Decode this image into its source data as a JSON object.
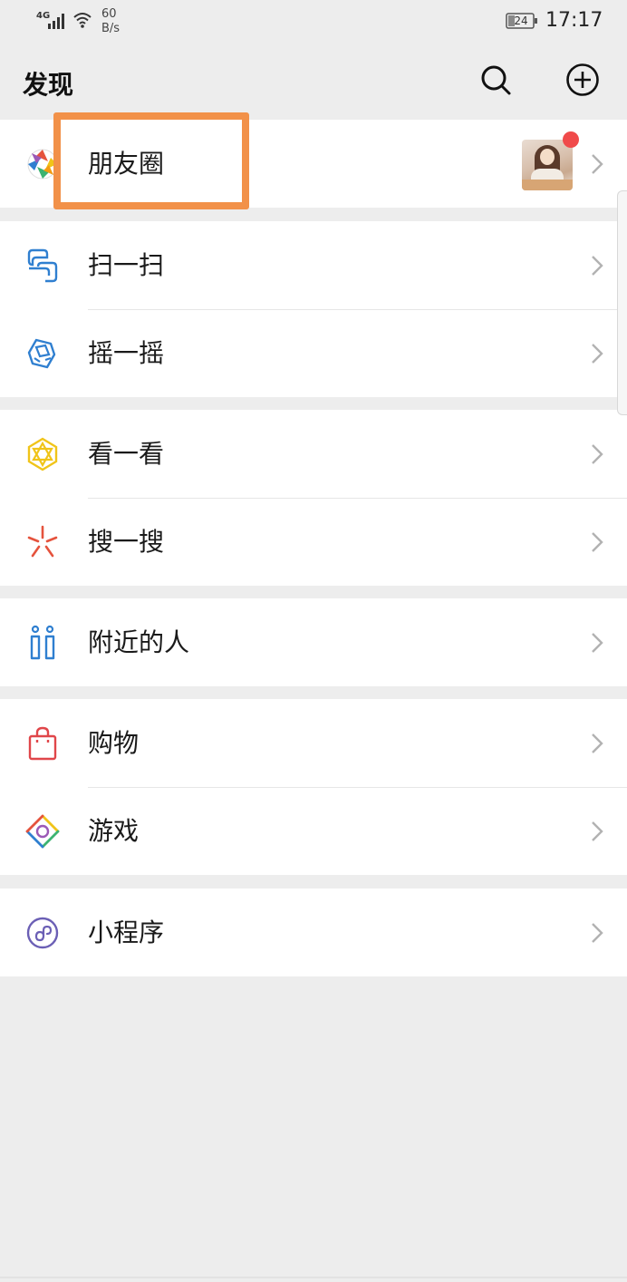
{
  "status_bar": {
    "network": "4G",
    "speed_value": "60",
    "speed_unit": "B/s",
    "battery": "24",
    "time": "17:17"
  },
  "header": {
    "title": "发现",
    "search_icon": "search-icon",
    "add_icon": "plus-circle-icon"
  },
  "groups": [
    [
      {
        "label": "朋友圈",
        "icon": "moments-icon",
        "has_thumbnail": true,
        "has_red_dot": true
      }
    ],
    [
      {
        "label": "扫一扫",
        "icon": "scan-icon"
      },
      {
        "label": "摇一摇",
        "icon": "shake-icon"
      }
    ],
    [
      {
        "label": "看一看",
        "icon": "top-stories-icon"
      },
      {
        "label": "搜一搜",
        "icon": "search-search-icon"
      }
    ],
    [
      {
        "label": "附近的人",
        "icon": "people-nearby-icon"
      }
    ],
    [
      {
        "label": "购物",
        "icon": "shopping-bag-icon"
      },
      {
        "label": "游戏",
        "icon": "games-icon"
      }
    ],
    [
      {
        "label": "小程序",
        "icon": "mini-programs-icon"
      }
    ]
  ],
  "colors": {
    "background": "#ededed",
    "highlight": "#f29149",
    "red_dot": "#f04a4a",
    "scan": "#2f7fd0",
    "top_stories": "#f0c419",
    "search": "#e5533d",
    "nearby": "#2f7fd0",
    "shopping": "#e0464a",
    "mini_programs": "#6b5fb5"
  }
}
